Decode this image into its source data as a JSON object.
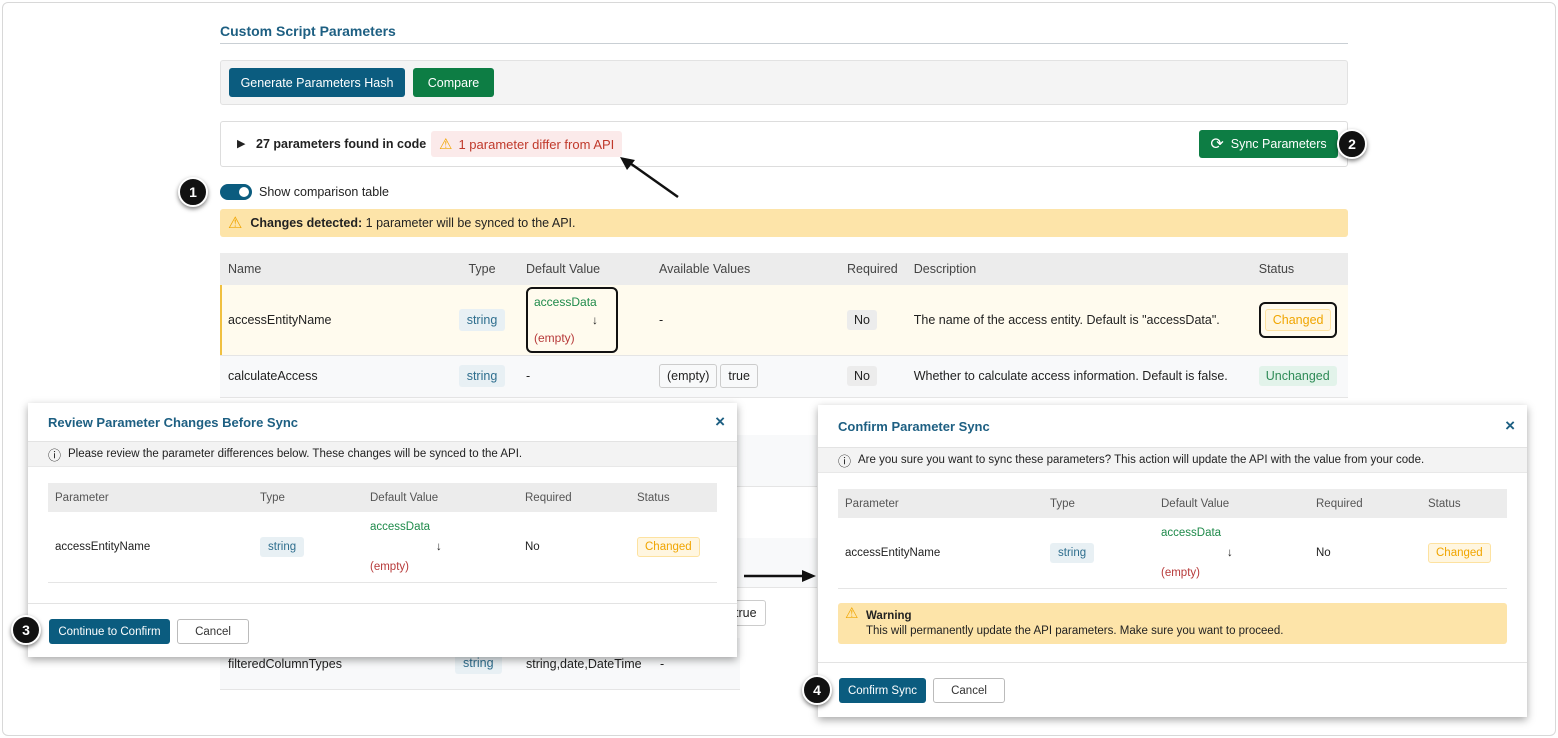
{
  "page": {
    "title": "Custom Script Parameters"
  },
  "toolbar": {
    "generate_label": "Generate Parameters Hash",
    "compare_label": "Compare"
  },
  "summary": {
    "found": "27 parameters found in code",
    "diff": "1 parameter differ from API",
    "sync_label": "Sync Parameters"
  },
  "toggle": {
    "label": "Show comparison table"
  },
  "alert": {
    "bold": "Changes detected:",
    "text": "1 parameter will be synced to the API."
  },
  "table": {
    "headers": [
      "Name",
      "Type",
      "Default Value",
      "Available Values",
      "Required",
      "Description",
      "Status"
    ],
    "rows": [
      {
        "name": "accessEntityName",
        "type": "string",
        "default_from": "accessData",
        "default_to": "(empty)",
        "available": "-",
        "required": "No",
        "description": "The name of the access entity. Default is \"accessData\".",
        "status": "Changed"
      },
      {
        "name": "calculateAccess",
        "type": "string",
        "default": "-",
        "available": [
          "(empty)",
          "true"
        ],
        "required": "No",
        "description": "Whether to calculate access information. Default is false.",
        "status": "Unchanged"
      }
    ],
    "partial_option": "true",
    "last_row": {
      "name": "filteredColumnTypes",
      "type": "string",
      "default": "string,date,DateTime",
      "available": "-"
    }
  },
  "review_modal": {
    "title": "Review Parameter Changes Before Sync",
    "info": "Please review the parameter differences below. These changes will be synced to the API.",
    "headers": [
      "Parameter",
      "Type",
      "Default Value",
      "Required",
      "Status"
    ],
    "row": {
      "name": "accessEntityName",
      "type": "string",
      "from": "accessData",
      "to": "(empty)",
      "required": "No",
      "status": "Changed"
    },
    "continue_label": "Continue to Confirm",
    "cancel_label": "Cancel"
  },
  "confirm_modal": {
    "title": "Confirm Parameter Sync",
    "info": "Are you sure you want to sync these parameters? This action will update the API with the value from your code.",
    "headers": [
      "Parameter",
      "Type",
      "Default Value",
      "Required",
      "Status"
    ],
    "row": {
      "name": "accessEntityName",
      "type": "string",
      "from": "accessData",
      "to": "(empty)",
      "required": "No",
      "status": "Changed"
    },
    "warning_title": "Warning",
    "warning_text": "This will permanently update the API parameters. Make sure you want to proceed.",
    "confirm_label": "Confirm Sync",
    "cancel_label": "Cancel"
  },
  "steps": [
    "1",
    "2",
    "3",
    "4"
  ],
  "icons": {
    "close": "×",
    "arrow": "↓",
    "expand": "▶",
    "warning": "⚠",
    "info": "ⓘ",
    "sync": "⟳"
  }
}
